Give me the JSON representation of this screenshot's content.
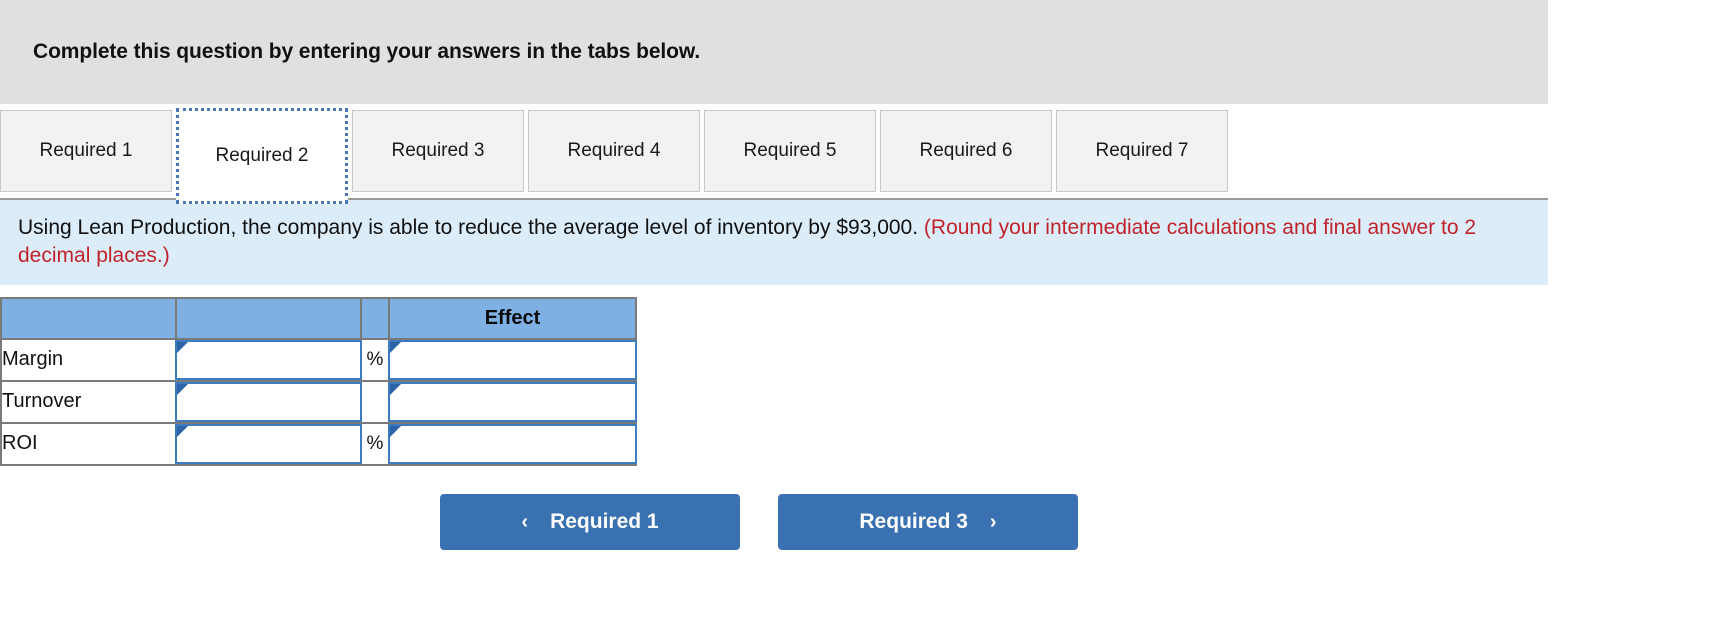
{
  "banner": {
    "text": "Complete this question by entering your answers in the tabs below."
  },
  "tabs": {
    "items": [
      {
        "label": "Required 1",
        "active": false
      },
      {
        "label": "Required 2",
        "active": true
      },
      {
        "label": "Required 3",
        "active": false
      },
      {
        "label": "Required 4",
        "active": false
      },
      {
        "label": "Required 5",
        "active": false
      },
      {
        "label": "Required 6",
        "active": false
      },
      {
        "label": "Required 7",
        "active": false
      }
    ]
  },
  "instruction": {
    "main": "Using Lean Production, the company is able to reduce the average level of inventory by $93,000. ",
    "note": "(Round your intermediate calculations and final answer to 2 decimal places.)"
  },
  "answer_table": {
    "headers": [
      "",
      "",
      "",
      "Effect"
    ],
    "rows": [
      {
        "label": "Margin",
        "value": "",
        "unit": "%",
        "effect": ""
      },
      {
        "label": "Turnover",
        "value": "",
        "unit": "",
        "effect": ""
      },
      {
        "label": "ROI",
        "value": "",
        "unit": "%",
        "effect": ""
      }
    ]
  },
  "nav": {
    "prev_label": "Required 1",
    "prev_icon": "chevron-left-icon",
    "prev_glyph": "‹",
    "next_label": "Required 3",
    "next_icon": "chevron-right-icon",
    "next_glyph": "›"
  },
  "colors": {
    "banner_bg": "#e0e0e0",
    "instruction_bg": "#dcecf8",
    "note_red": "#c0242a",
    "table_header_blue": "#7fb0e3",
    "button_blue": "#3a71b0",
    "field_border": "#3f7cbf",
    "active_tab_border": "#4a77b4"
  }
}
